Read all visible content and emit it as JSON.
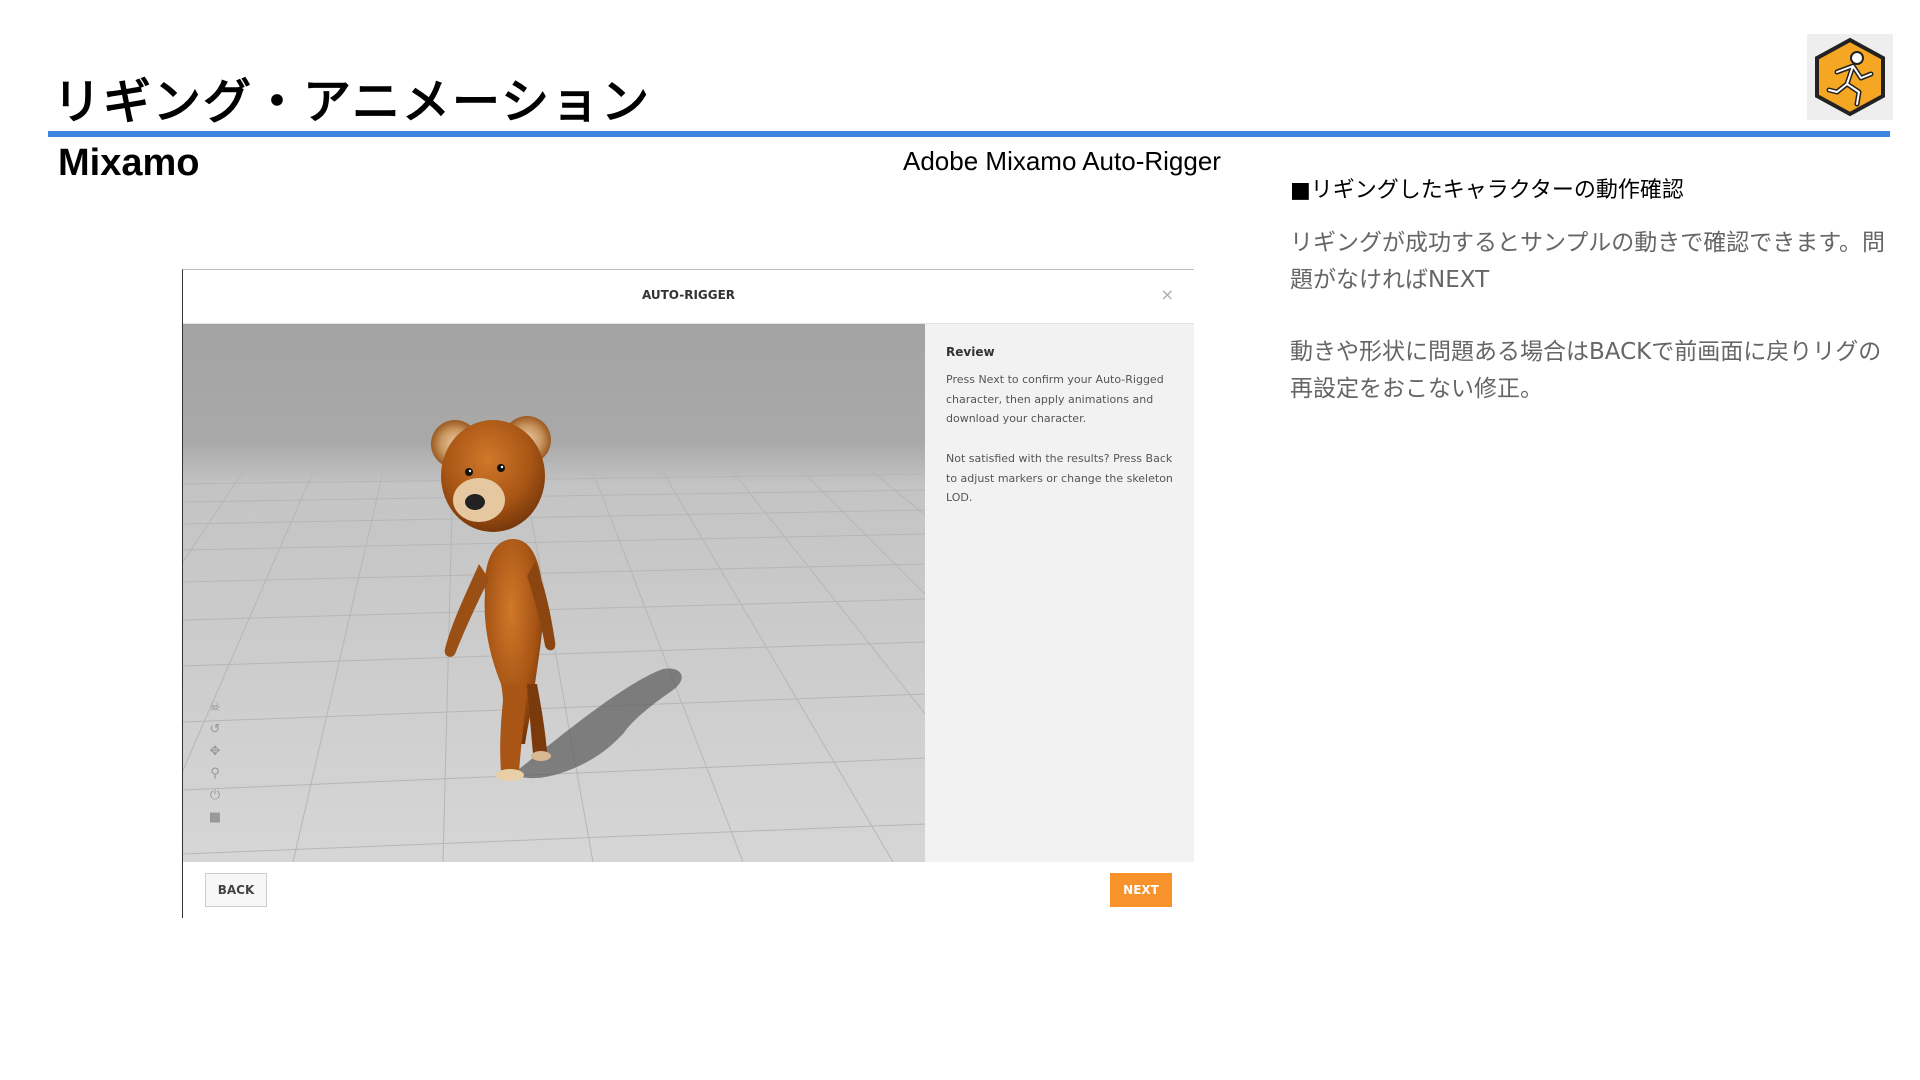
{
  "slide": {
    "title": "リギング・アニメーション",
    "subtitle": "Mixamo",
    "caption": "Adobe Mixamo Auto-Rigger",
    "rule_color": "#3d85de"
  },
  "logo": {
    "icon": "running-man-hexagon-icon",
    "color": "#f5a623"
  },
  "notes": {
    "heading": "■リギングしたキャラクターの動作確認",
    "paragraph1": "リギングが成功するとサンプルの動きで確認できます。問題がなければNEXT",
    "paragraph2": "動きや形状に問題ある場合はBACKで前画面に戻りリグの再設定をおこない修正。"
  },
  "screenshot": {
    "dialog_title": "AUTO-RIGGER",
    "close_icon": "×",
    "review": {
      "title": "Review",
      "paragraph1": "Press Next to confirm your Auto-Rigged character, then apply animations and download your character.",
      "paragraph2": "Not satisfied with the results? Press Back to adjust markers or change the skeleton LOD."
    },
    "tools": [
      "skull-icon",
      "rotate-icon",
      "move-icon",
      "zoom-icon",
      "power-icon",
      "camera-icon"
    ],
    "back_label": "BACK",
    "next_label": "NEXT",
    "accent": "#f7932a"
  }
}
